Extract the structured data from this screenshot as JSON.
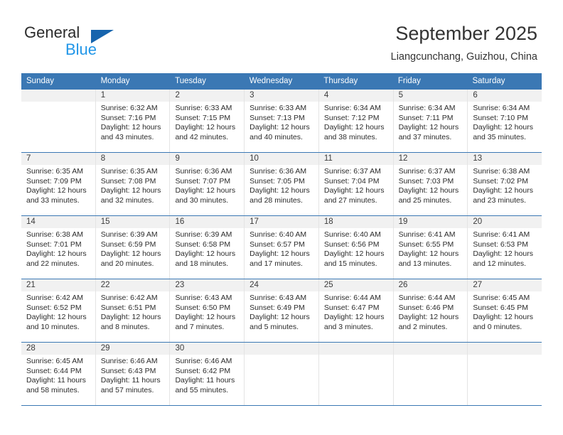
{
  "brand": {
    "name_part1": "General",
    "name_part2": "Blue",
    "flag_icon": "triangle-flag-icon",
    "colors": {
      "flag": "#1664ad",
      "blue_text": "#2196e8",
      "dark_text": "#2b2b2b"
    }
  },
  "header": {
    "title": "September 2025",
    "subtitle": "Liangcunchang, Guizhou, China"
  },
  "theme": {
    "header_blue": "#3b78b4",
    "day_band_gray": "#f1f1f1",
    "cell_border": "#e4e4e4"
  },
  "weekdays": [
    "Sunday",
    "Monday",
    "Tuesday",
    "Wednesday",
    "Thursday",
    "Friday",
    "Saturday"
  ],
  "weeks": [
    [
      {
        "day": "",
        "sunrise": "",
        "sunset": "",
        "daylight": "",
        "empty": true
      },
      {
        "day": "1",
        "sunrise": "Sunrise: 6:32 AM",
        "sunset": "Sunset: 7:16 PM",
        "daylight": "Daylight: 12 hours and 43 minutes.",
        "empty": false
      },
      {
        "day": "2",
        "sunrise": "Sunrise: 6:33 AM",
        "sunset": "Sunset: 7:15 PM",
        "daylight": "Daylight: 12 hours and 42 minutes.",
        "empty": false
      },
      {
        "day": "3",
        "sunrise": "Sunrise: 6:33 AM",
        "sunset": "Sunset: 7:13 PM",
        "daylight": "Daylight: 12 hours and 40 minutes.",
        "empty": false
      },
      {
        "day": "4",
        "sunrise": "Sunrise: 6:34 AM",
        "sunset": "Sunset: 7:12 PM",
        "daylight": "Daylight: 12 hours and 38 minutes.",
        "empty": false
      },
      {
        "day": "5",
        "sunrise": "Sunrise: 6:34 AM",
        "sunset": "Sunset: 7:11 PM",
        "daylight": "Daylight: 12 hours and 37 minutes.",
        "empty": false
      },
      {
        "day": "6",
        "sunrise": "Sunrise: 6:34 AM",
        "sunset": "Sunset: 7:10 PM",
        "daylight": "Daylight: 12 hours and 35 minutes.",
        "empty": false
      }
    ],
    [
      {
        "day": "7",
        "sunrise": "Sunrise: 6:35 AM",
        "sunset": "Sunset: 7:09 PM",
        "daylight": "Daylight: 12 hours and 33 minutes.",
        "empty": false
      },
      {
        "day": "8",
        "sunrise": "Sunrise: 6:35 AM",
        "sunset": "Sunset: 7:08 PM",
        "daylight": "Daylight: 12 hours and 32 minutes.",
        "empty": false
      },
      {
        "day": "9",
        "sunrise": "Sunrise: 6:36 AM",
        "sunset": "Sunset: 7:07 PM",
        "daylight": "Daylight: 12 hours and 30 minutes.",
        "empty": false
      },
      {
        "day": "10",
        "sunrise": "Sunrise: 6:36 AM",
        "sunset": "Sunset: 7:05 PM",
        "daylight": "Daylight: 12 hours and 28 minutes.",
        "empty": false
      },
      {
        "day": "11",
        "sunrise": "Sunrise: 6:37 AM",
        "sunset": "Sunset: 7:04 PM",
        "daylight": "Daylight: 12 hours and 27 minutes.",
        "empty": false
      },
      {
        "day": "12",
        "sunrise": "Sunrise: 6:37 AM",
        "sunset": "Sunset: 7:03 PM",
        "daylight": "Daylight: 12 hours and 25 minutes.",
        "empty": false
      },
      {
        "day": "13",
        "sunrise": "Sunrise: 6:38 AM",
        "sunset": "Sunset: 7:02 PM",
        "daylight": "Daylight: 12 hours and 23 minutes.",
        "empty": false
      }
    ],
    [
      {
        "day": "14",
        "sunrise": "Sunrise: 6:38 AM",
        "sunset": "Sunset: 7:01 PM",
        "daylight": "Daylight: 12 hours and 22 minutes.",
        "empty": false
      },
      {
        "day": "15",
        "sunrise": "Sunrise: 6:39 AM",
        "sunset": "Sunset: 6:59 PM",
        "daylight": "Daylight: 12 hours and 20 minutes.",
        "empty": false
      },
      {
        "day": "16",
        "sunrise": "Sunrise: 6:39 AM",
        "sunset": "Sunset: 6:58 PM",
        "daylight": "Daylight: 12 hours and 18 minutes.",
        "empty": false
      },
      {
        "day": "17",
        "sunrise": "Sunrise: 6:40 AM",
        "sunset": "Sunset: 6:57 PM",
        "daylight": "Daylight: 12 hours and 17 minutes.",
        "empty": false
      },
      {
        "day": "18",
        "sunrise": "Sunrise: 6:40 AM",
        "sunset": "Sunset: 6:56 PM",
        "daylight": "Daylight: 12 hours and 15 minutes.",
        "empty": false
      },
      {
        "day": "19",
        "sunrise": "Sunrise: 6:41 AM",
        "sunset": "Sunset: 6:55 PM",
        "daylight": "Daylight: 12 hours and 13 minutes.",
        "empty": false
      },
      {
        "day": "20",
        "sunrise": "Sunrise: 6:41 AM",
        "sunset": "Sunset: 6:53 PM",
        "daylight": "Daylight: 12 hours and 12 minutes.",
        "empty": false
      }
    ],
    [
      {
        "day": "21",
        "sunrise": "Sunrise: 6:42 AM",
        "sunset": "Sunset: 6:52 PM",
        "daylight": "Daylight: 12 hours and 10 minutes.",
        "empty": false
      },
      {
        "day": "22",
        "sunrise": "Sunrise: 6:42 AM",
        "sunset": "Sunset: 6:51 PM",
        "daylight": "Daylight: 12 hours and 8 minutes.",
        "empty": false
      },
      {
        "day": "23",
        "sunrise": "Sunrise: 6:43 AM",
        "sunset": "Sunset: 6:50 PM",
        "daylight": "Daylight: 12 hours and 7 minutes.",
        "empty": false
      },
      {
        "day": "24",
        "sunrise": "Sunrise: 6:43 AM",
        "sunset": "Sunset: 6:49 PM",
        "daylight": "Daylight: 12 hours and 5 minutes.",
        "empty": false
      },
      {
        "day": "25",
        "sunrise": "Sunrise: 6:44 AM",
        "sunset": "Sunset: 6:47 PM",
        "daylight": "Daylight: 12 hours and 3 minutes.",
        "empty": false
      },
      {
        "day": "26",
        "sunrise": "Sunrise: 6:44 AM",
        "sunset": "Sunset: 6:46 PM",
        "daylight": "Daylight: 12 hours and 2 minutes.",
        "empty": false
      },
      {
        "day": "27",
        "sunrise": "Sunrise: 6:45 AM",
        "sunset": "Sunset: 6:45 PM",
        "daylight": "Daylight: 12 hours and 0 minutes.",
        "empty": false
      }
    ],
    [
      {
        "day": "28",
        "sunrise": "Sunrise: 6:45 AM",
        "sunset": "Sunset: 6:44 PM",
        "daylight": "Daylight: 11 hours and 58 minutes.",
        "empty": false
      },
      {
        "day": "29",
        "sunrise": "Sunrise: 6:46 AM",
        "sunset": "Sunset: 6:43 PM",
        "daylight": "Daylight: 11 hours and 57 minutes.",
        "empty": false
      },
      {
        "day": "30",
        "sunrise": "Sunrise: 6:46 AM",
        "sunset": "Sunset: 6:42 PM",
        "daylight": "Daylight: 11 hours and 55 minutes.",
        "empty": false
      },
      {
        "day": "",
        "sunrise": "",
        "sunset": "",
        "daylight": "",
        "empty": true
      },
      {
        "day": "",
        "sunrise": "",
        "sunset": "",
        "daylight": "",
        "empty": true
      },
      {
        "day": "",
        "sunrise": "",
        "sunset": "",
        "daylight": "",
        "empty": true
      },
      {
        "day": "",
        "sunrise": "",
        "sunset": "",
        "daylight": "",
        "empty": true
      }
    ]
  ]
}
